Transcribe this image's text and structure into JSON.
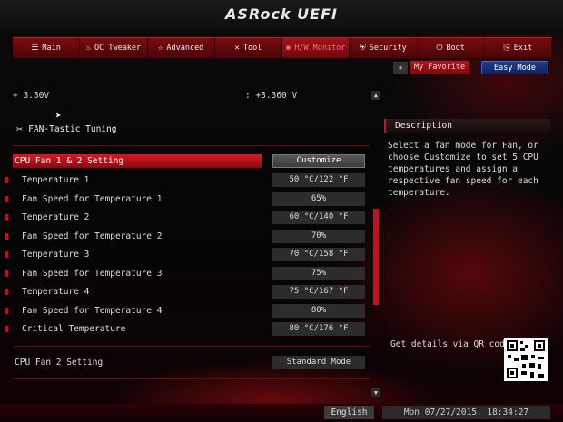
{
  "header": {
    "logo": "ASRock UEFI"
  },
  "tabs": [
    {
      "icon": "list-icon",
      "label": "Main"
    },
    {
      "icon": "flame-icon",
      "label": "OC Tweaker"
    },
    {
      "icon": "star-icon",
      "label": "Advanced"
    },
    {
      "icon": "tool-icon",
      "label": "Tool"
    },
    {
      "icon": "monitor-icon",
      "label": "H/W Monitor",
      "active": true
    },
    {
      "icon": "shield-icon",
      "label": "Security"
    },
    {
      "icon": "power-icon",
      "label": "Boot"
    },
    {
      "icon": "exit-icon",
      "label": "Exit"
    }
  ],
  "top_buttons": {
    "favorite_label": "My Favorite",
    "easy_mode_label": "Easy Mode"
  },
  "voltage": {
    "label": "+ 3.30V",
    "value": ": +3.360 V"
  },
  "section": {
    "title": "FAN-Tastic Tuning"
  },
  "rows": [
    {
      "label": "CPU Fan 1 & 2 Setting",
      "value": "Customize"
    },
    {
      "label": "Temperature 1",
      "value": "50 °C/122 °F"
    },
    {
      "label": "Fan Speed for Temperature 1",
      "value": "65%"
    },
    {
      "label": "Temperature 2",
      "value": "60 °C/140 °F"
    },
    {
      "label": "Fan Speed for Temperature 2",
      "value": "70%"
    },
    {
      "label": "Temperature 3",
      "value": "70 °C/158 °F"
    },
    {
      "label": "Fan Speed for Temperature 3",
      "value": "75%"
    },
    {
      "label": "Temperature 4",
      "value": "75 °C/167 °F"
    },
    {
      "label": "Fan Speed for Temperature 4",
      "value": "80%"
    },
    {
      "label": "Critical Temperature",
      "value": "80 °C/176 °F"
    }
  ],
  "cpu_fan2": {
    "label": "CPU Fan 2 Setting",
    "value": "Standard Mode"
  },
  "description": {
    "title": "Description",
    "text": "Select a fan mode for Fan, or choose Customize to set 5 CPU temperatures and assign a respective fan speed for each temperature."
  },
  "qr": {
    "label": "Get details via QR code"
  },
  "footer": {
    "language": "English",
    "datetime": "Mon 07/27/2015. 18:34:27"
  },
  "colors": {
    "accent": "#c0121a",
    "easy_mode": "#1d3f8a"
  }
}
